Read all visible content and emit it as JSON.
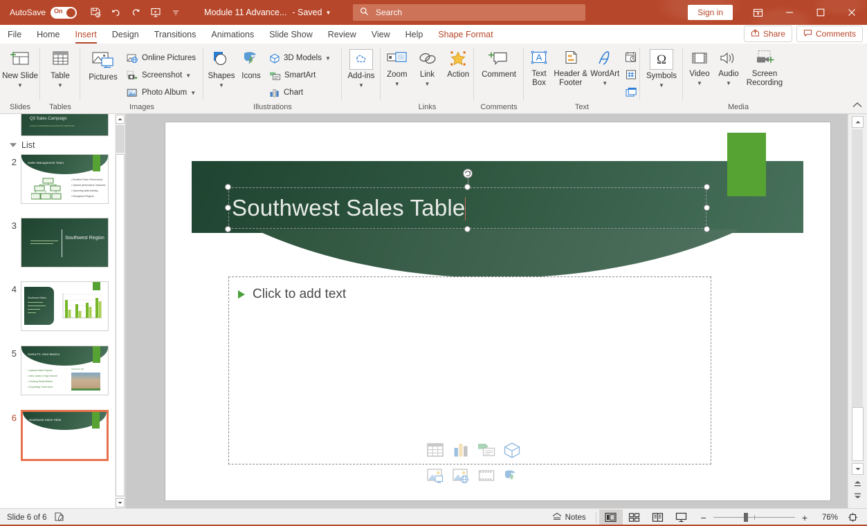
{
  "titlebar": {
    "autosave_label": "AutoSave",
    "autosave_state": "On",
    "qat": [
      {
        "name": "save-icon",
        "tip": "Save"
      },
      {
        "name": "undo-icon",
        "tip": "Undo"
      },
      {
        "name": "redo-icon",
        "tip": "Redo"
      },
      {
        "name": "start-presentation-icon",
        "tip": "Start From Beginning"
      },
      {
        "name": "customize-qat-icon",
        "tip": "Customize Quick Access Toolbar"
      }
    ],
    "document_title": "Module 11 Advance...",
    "saved_label": "- Saved",
    "search_placeholder": "Search",
    "sign_in_label": "Sign in",
    "ribbon_display_tip": "Ribbon Display Options",
    "minimize_tip": "Minimize",
    "restore_tip": "Restore Down",
    "close_tip": "Close"
  },
  "tabs": {
    "items": [
      {
        "label": "File",
        "active": false,
        "contextual": false
      },
      {
        "label": "Home",
        "active": false,
        "contextual": false
      },
      {
        "label": "Insert",
        "active": true,
        "contextual": false
      },
      {
        "label": "Design",
        "active": false,
        "contextual": false
      },
      {
        "label": "Transitions",
        "active": false,
        "contextual": false
      },
      {
        "label": "Animations",
        "active": false,
        "contextual": false
      },
      {
        "label": "Slide Show",
        "active": false,
        "contextual": false
      },
      {
        "label": "Review",
        "active": false,
        "contextual": false
      },
      {
        "label": "View",
        "active": false,
        "contextual": false
      },
      {
        "label": "Help",
        "active": false,
        "contextual": false
      },
      {
        "label": "Shape Format",
        "active": false,
        "contextual": true
      }
    ],
    "share_label": "Share",
    "comments_label": "Comments"
  },
  "ribbon": {
    "groups": [
      {
        "label": "Slides",
        "items": [
          {
            "label": "New Slide",
            "icon": "new-slide-icon",
            "dropdown": true
          }
        ]
      },
      {
        "label": "Tables",
        "items": [
          {
            "label": "Table",
            "icon": "table-icon",
            "dropdown": true
          }
        ]
      },
      {
        "label": "Images",
        "items": [
          {
            "label": "Pictures",
            "icon": "pictures-icon",
            "dropdown": false
          },
          {
            "label": "Online Pictures",
            "icon": "online-pictures-icon",
            "dropdown": false
          },
          {
            "label": "Screenshot",
            "icon": "screenshot-icon",
            "dropdown": true
          },
          {
            "label": "Photo Album",
            "icon": "photo-album-icon",
            "dropdown": true
          }
        ]
      },
      {
        "label": "Illustrations",
        "items": [
          {
            "label": "Shapes",
            "icon": "shapes-icon",
            "dropdown": true
          },
          {
            "label": "Icons",
            "icon": "icons-icon",
            "dropdown": false
          },
          {
            "label": "3D Models",
            "icon": "3d-models-icon",
            "dropdown": true
          },
          {
            "label": "SmartArt",
            "icon": "smartart-icon",
            "dropdown": false
          },
          {
            "label": "Chart",
            "icon": "chart-icon",
            "dropdown": false
          }
        ]
      },
      {
        "label": "",
        "items": [
          {
            "label": "Add-ins",
            "icon": "add-ins-icon",
            "dropdown": true
          }
        ]
      },
      {
        "label": "Links",
        "items": [
          {
            "label": "Zoom",
            "icon": "zoom-icon",
            "dropdown": true
          },
          {
            "label": "Link",
            "icon": "link-icon",
            "dropdown": true
          },
          {
            "label": "Action",
            "icon": "action-icon",
            "dropdown": false
          }
        ]
      },
      {
        "label": "Comments",
        "items": [
          {
            "label": "Comment",
            "icon": "comment-icon",
            "dropdown": false
          }
        ]
      },
      {
        "label": "Text",
        "items": [
          {
            "label": "Text Box",
            "icon": "text-box-icon",
            "dropdown": false
          },
          {
            "label": "Header & Footer",
            "icon": "header-footer-icon",
            "dropdown": false
          },
          {
            "label": "WordArt",
            "icon": "wordart-icon",
            "dropdown": true
          },
          {
            "label": "Date & Time",
            "icon": "date-time-icon",
            "dropdown": false
          },
          {
            "label": "Slide Number",
            "icon": "slide-number-icon",
            "dropdown": false
          },
          {
            "label": "Object",
            "icon": "object-icon",
            "dropdown": false
          }
        ]
      },
      {
        "label": "",
        "items": [
          {
            "label": "Symbols",
            "icon": "symbols-icon",
            "dropdown": true
          }
        ]
      },
      {
        "label": "Media",
        "items": [
          {
            "label": "Video",
            "icon": "video-icon",
            "dropdown": true
          },
          {
            "label": "Audio",
            "icon": "audio-icon",
            "dropdown": true
          },
          {
            "label": "Screen Recording",
            "icon": "screen-recording-icon",
            "dropdown": false
          }
        ]
      }
    ],
    "collapse_tip": "Collapse the Ribbon"
  },
  "labels": {
    "new_slide": "New Slide",
    "table": "Table",
    "pictures": "Pictures",
    "online_pictures": "Online Pictures",
    "screenshot": "Screenshot",
    "photo_album": "Photo Album",
    "shapes": "Shapes",
    "icons": "Icons",
    "models3d": "3D Models",
    "smartart": "SmartArt",
    "chart": "Chart",
    "addins": "Add-ins",
    "zoom": "Zoom",
    "link": "Link",
    "action": "Action",
    "comment": "Comment",
    "textbox": "Text Box",
    "headerfooter": "Header & Footer",
    "wordart": "WordArt",
    "symbols": "Symbols",
    "video": "Video",
    "audio": "Audio",
    "screenrecording": "Screen Recording",
    "g_slides": "Slides",
    "g_tables": "Tables",
    "g_images": "Images",
    "g_illustrations": "Illustrations",
    "g_links": "Links",
    "g_comments": "Comments",
    "g_text": "Text",
    "g_media": "Media"
  },
  "thumbnails": {
    "section_label": "List",
    "slides": [
      {
        "number": "1",
        "title": "Q3 Sales Campaign",
        "type": "title",
        "selected": false,
        "subtitle": "SALES CONFERENCE ADVANCED SERVICES"
      },
      {
        "number": "2",
        "title": "Sales Management Team",
        "type": "content-org",
        "selected": false,
        "bullets": [
          "Excellent Team Performance",
          "Upward performance measures",
          "Upcoming sales training",
          "Reorganize Regions"
        ]
      },
      {
        "number": "3",
        "title": "Southwest Region",
        "type": "section",
        "selected": false,
        "subtitle": "SALES ANALYTICS PRESENTATION"
      },
      {
        "number": "4",
        "title": "Southwest Sales",
        "type": "chart",
        "selected": false
      },
      {
        "number": "5",
        "title": "Santa Fe, New Mexico",
        "type": "picture",
        "selected": false,
        "bullets": [
          "Upward Sales Figures",
          "New Leads in High Volume",
          "Growing Retail Market",
          "Expanding Travel Area"
        ]
      },
      {
        "number": "6",
        "title": "Southwest Sales Table",
        "type": "title-only",
        "selected": true
      }
    ]
  },
  "slide": {
    "title": "Southwest Sales Table",
    "content_placeholder_prompt": "Click to add text",
    "content_icons": [
      "insert-table-icon",
      "insert-chart-icon",
      "insert-smartart-icon",
      "insert-3d-model-icon",
      "insert-pictures-icon",
      "insert-online-pictures-icon",
      "insert-video-icon",
      "insert-icons-icon"
    ]
  },
  "status": {
    "slide_counter": "Slide 6 of 6",
    "accessibility_tip": "Accessibility: Investigate",
    "notes_label": "Notes",
    "views": [
      {
        "name": "normal-view",
        "label": "Normal",
        "active": true
      },
      {
        "name": "slide-sorter-view",
        "label": "Slide Sorter",
        "active": false
      },
      {
        "name": "reading-view",
        "label": "Reading View",
        "active": false
      },
      {
        "name": "slide-show-view",
        "label": "Slide Show",
        "active": false
      }
    ],
    "zoom_out_label": "−",
    "zoom_in_label": "+",
    "zoom_percent": "76%",
    "fit_tip": "Fit slide to current window"
  },
  "colors": {
    "brand": "#b7472a",
    "accent_green": "#56a233",
    "slide_dark_green": "#2f5740",
    "selection_orange": "#e8714d"
  }
}
